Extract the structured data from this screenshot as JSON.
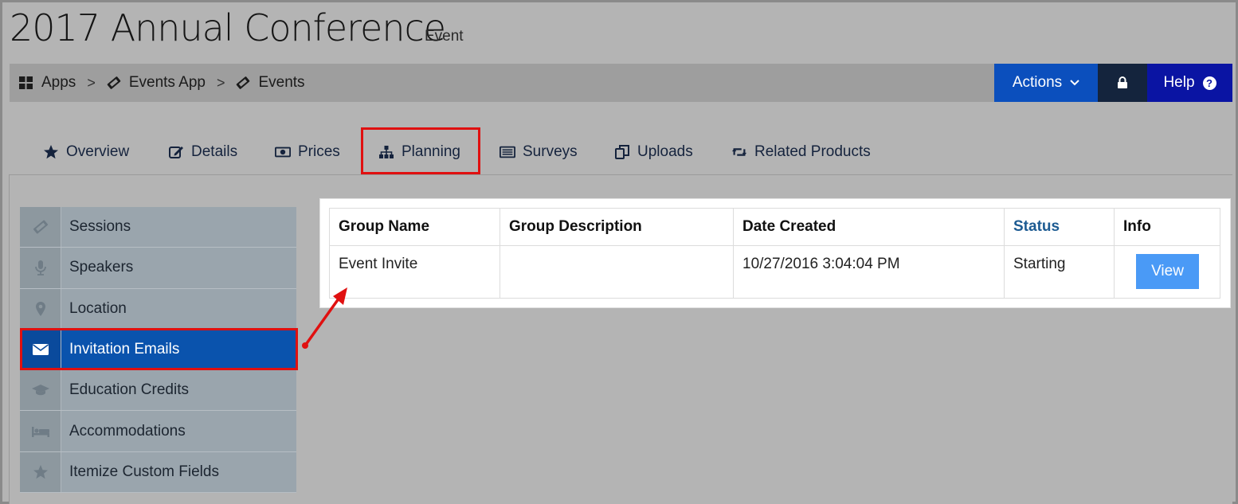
{
  "page": {
    "title": "2017 Annual Conference",
    "subtitle": "Event"
  },
  "breadcrumb": {
    "items": [
      {
        "label": "Apps",
        "icon": "grid-icon"
      },
      {
        "label": "Events App",
        "icon": "ticket-icon"
      },
      {
        "label": "Events",
        "icon": "ticket-icon"
      }
    ],
    "separator": ">"
  },
  "header_buttons": {
    "actions_label": "Actions",
    "help_label": "Help"
  },
  "tabs": [
    {
      "label": "Overview",
      "icon": "star-icon"
    },
    {
      "label": "Details",
      "icon": "edit-icon"
    },
    {
      "label": "Prices",
      "icon": "money-icon"
    },
    {
      "label": "Planning",
      "icon": "sitemap-icon"
    },
    {
      "label": "Surveys",
      "icon": "list-icon"
    },
    {
      "label": "Uploads",
      "icon": "copy-icon"
    },
    {
      "label": "Related Products",
      "icon": "retweet-icon"
    }
  ],
  "sidebar": {
    "items": [
      {
        "label": "Sessions",
        "icon": "ticket-icon"
      },
      {
        "label": "Speakers",
        "icon": "microphone-icon"
      },
      {
        "label": "Location",
        "icon": "map-marker-icon"
      },
      {
        "label": "Invitation Emails",
        "icon": "envelope-icon",
        "active": true
      },
      {
        "label": "Education Credits",
        "icon": "graduation-cap-icon"
      },
      {
        "label": "Accommodations",
        "icon": "bed-icon"
      },
      {
        "label": "Itemize Custom Fields",
        "icon": "star-icon"
      }
    ]
  },
  "table": {
    "headers": [
      "Group Name",
      "Group Description",
      "Date Created",
      "Status",
      "Info"
    ],
    "rows": [
      {
        "group_name": "Event Invite",
        "group_description": "",
        "date_created": "10/27/2016 3:04:04 PM",
        "status": "Starting",
        "info_button": "View"
      }
    ]
  },
  "colors": {
    "accent_blue": "#0b4fbd",
    "active_item": "#0a53ad",
    "highlight_red": "#e01010",
    "view_button": "#4a9af6",
    "status_header": "#1d5b92"
  }
}
